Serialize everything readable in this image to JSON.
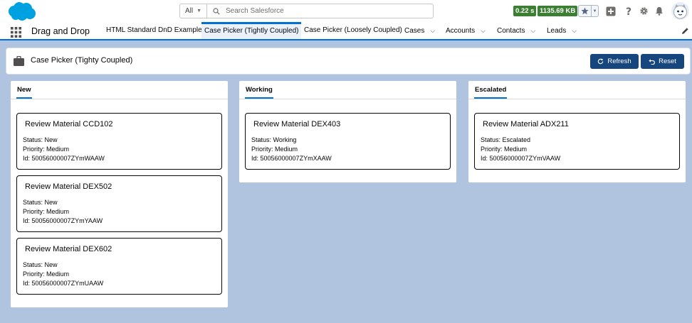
{
  "header": {
    "search_scope": "All",
    "search_placeholder": "Search Salesforce",
    "perf_time": "0.22 s",
    "perf_memory": "1135.69 KB"
  },
  "nav": {
    "app_name": "Drag and Drop",
    "tabs": [
      {
        "label": "HTML Standard DnD Example"
      },
      {
        "label": "Case Picker (Tightly Coupled)"
      },
      {
        "label": "Case Picker (Loosely Coupled)"
      },
      {
        "label": "Cases"
      },
      {
        "label": "Accounts"
      },
      {
        "label": "Contacts"
      },
      {
        "label": "Leads"
      }
    ]
  },
  "page": {
    "title": "Case Picker (Tighty Coupled)",
    "refresh_label": "Refresh",
    "reset_label": "Reset"
  },
  "columns": [
    {
      "label": "New",
      "cases": [
        {
          "title": "Review Material CCD102",
          "status": "Status: New",
          "priority": "Priority: Medium",
          "id": "Id: 50056000007ZYmWAAW"
        },
        {
          "title": "Review Material DEX502",
          "status": "Status: New",
          "priority": "Priority: Medium",
          "id": "Id: 50056000007ZYmYAAW"
        },
        {
          "title": "Review Material DEX602",
          "status": "Status: New",
          "priority": "Priority: Medium",
          "id": "Id: 50056000007ZYmUAAW"
        }
      ]
    },
    {
      "label": "Working",
      "cases": [
        {
          "title": "Review Material DEX403",
          "status": "Status: Working",
          "priority": "Priority: Medium",
          "id": "Id: 50056000007ZYmXAAW"
        }
      ]
    },
    {
      "label": "Escalated",
      "cases": [
        {
          "title": "Review Material ADX211",
          "status": "Status: Escalated",
          "priority": "Priority: Medium",
          "id": "Id: 50056000007ZYmVAAW"
        }
      ]
    }
  ],
  "colors": {
    "brand": "#0070d2",
    "button": "#16467e",
    "background": "#b0c4df",
    "perf_badge": "#3a7f32"
  }
}
